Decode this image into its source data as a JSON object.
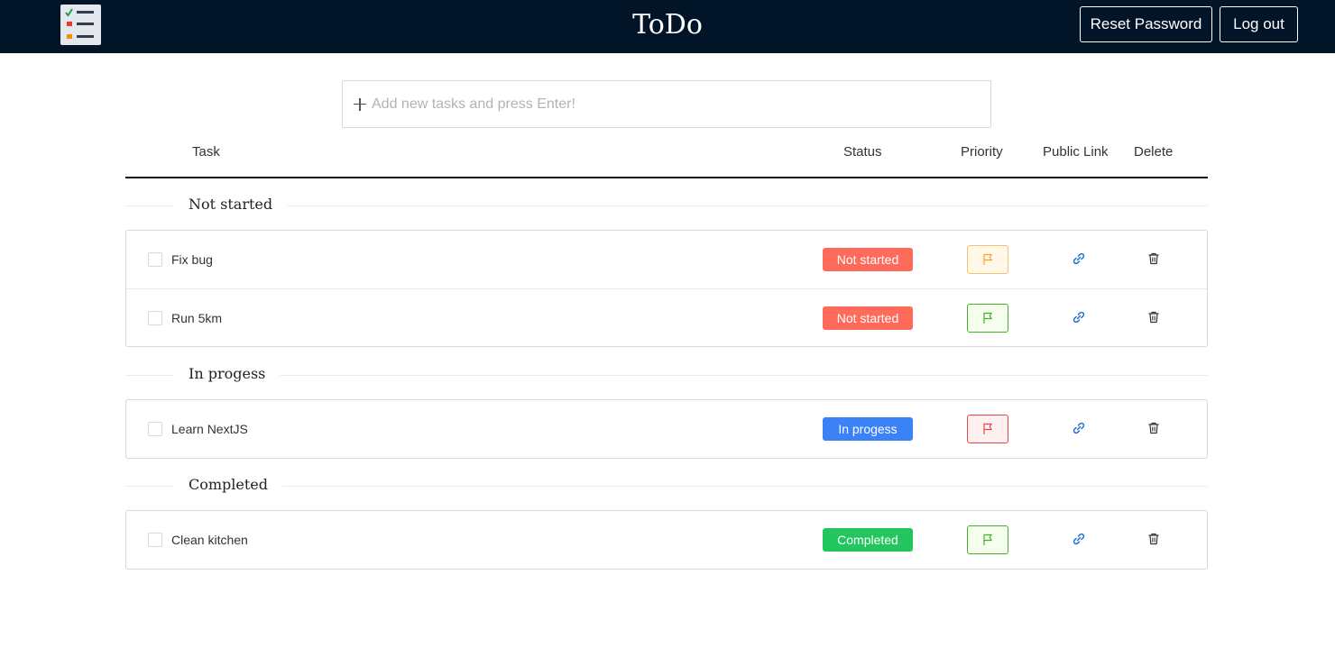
{
  "header": {
    "title": "ToDo",
    "reset_password_label": "Reset Password",
    "logout_label": "Log out",
    "logo_icon": "checklist-icon"
  },
  "add_task": {
    "placeholder": "Add new tasks and press Enter!",
    "value": "",
    "icon": "plus-icon"
  },
  "columns": {
    "task": "Task",
    "status": "Status",
    "priority": "Priority",
    "public_link": "Public Link",
    "delete": "Delete"
  },
  "groups": [
    {
      "title": "Not started",
      "tasks": [
        {
          "text": "Fix bug",
          "status": "Not started",
          "priority": "medium",
          "checked": false
        },
        {
          "text": "Run 5km",
          "status": "Not started",
          "priority": "low",
          "checked": false
        }
      ]
    },
    {
      "title": "In progess",
      "tasks": [
        {
          "text": "Learn NextJS",
          "status": "In progess",
          "priority": "high",
          "checked": false
        }
      ]
    },
    {
      "title": "Completed",
      "tasks": [
        {
          "text": "Clean kitchen",
          "status": "Completed",
          "priority": "low",
          "checked": false
        }
      ]
    }
  ],
  "colors": {
    "navbar_bg": "#021528",
    "status_not_started": "#ff6b5b",
    "status_in_progress": "#3b82f6",
    "status_completed": "#22c55e",
    "priority_high": "#e5484d",
    "priority_medium": "#f5a623",
    "priority_low": "#43b02a",
    "link_icon": "#1f6fd1"
  }
}
